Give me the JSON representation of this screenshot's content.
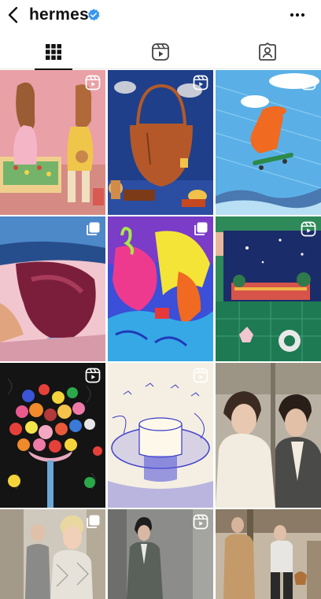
{
  "header": {
    "title": "hermes",
    "back_icon": "chevron-left-icon",
    "verified_icon": "verified-badge-icon",
    "more_icon": "more-horizontal-icon",
    "accent_color": "#3897f0"
  },
  "tabs": [
    {
      "name": "posts",
      "icon": "grid-icon",
      "active": true
    },
    {
      "name": "reels",
      "icon": "reels-icon",
      "active": false
    },
    {
      "name": "tagged",
      "icon": "tagged-person-icon",
      "active": false
    }
  ],
  "posts": [
    {
      "type": "reel",
      "description_icon": "reels-icon"
    },
    {
      "type": "reel",
      "description_icon": "reels-icon"
    },
    {
      "type": "reel",
      "description_icon": "reels-icon"
    },
    {
      "type": "carousel",
      "description_icon": "carousel-icon"
    },
    {
      "type": "carousel",
      "description_icon": "carousel-icon"
    },
    {
      "type": "reel",
      "description_icon": "reels-icon"
    },
    {
      "type": "reel",
      "description_icon": "reels-icon"
    },
    {
      "type": "reel",
      "description_icon": "reels-icon"
    },
    {
      "type": "none",
      "description_icon": ""
    },
    {
      "type": "carousel",
      "description_icon": "carousel-icon"
    },
    {
      "type": "reel",
      "description_icon": "reels-icon"
    },
    {
      "type": "none",
      "description_icon": ""
    }
  ]
}
